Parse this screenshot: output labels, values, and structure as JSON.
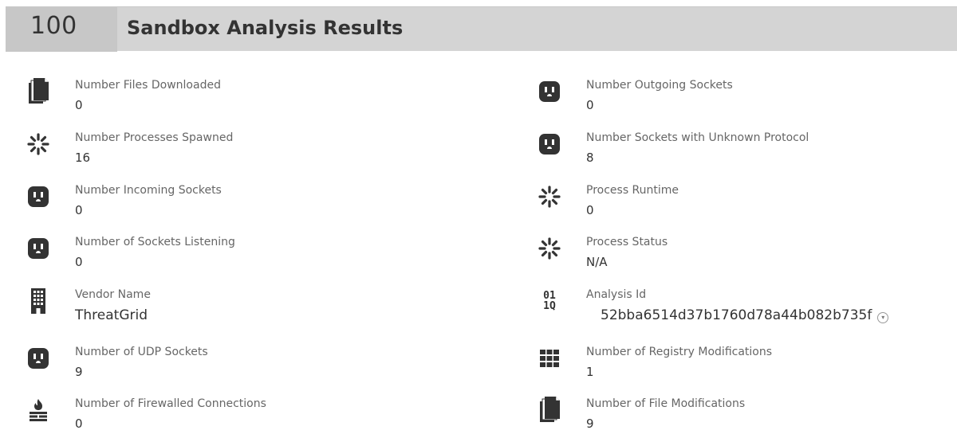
{
  "header": {
    "score": "100",
    "title": "Sandbox Analysis Results"
  },
  "left": [
    {
      "label": "Number Files Downloaded",
      "value": "0",
      "icon": "document-icon"
    },
    {
      "label": "Number Processes Spawned",
      "value": "16",
      "icon": "spinner-icon"
    },
    {
      "label": "Number Incoming Sockets",
      "value": "0",
      "icon": "socket-icon"
    },
    {
      "label": "Number of Sockets Listening",
      "value": "0",
      "icon": "socket-icon"
    },
    {
      "label": "Vendor Name",
      "value": "ThreatGrid",
      "icon": "building-icon"
    },
    {
      "label": "Number of UDP Sockets",
      "value": "9",
      "icon": "socket-icon"
    },
    {
      "label": "Number of Firewalled Connections",
      "value": "0",
      "icon": "firewall-icon"
    }
  ],
  "right": [
    {
      "label": "Number Outgoing Sockets",
      "value": "0",
      "icon": "socket-icon"
    },
    {
      "label": "Number Sockets with Unknown Protocol",
      "value": "8",
      "icon": "socket-icon"
    },
    {
      "label": "Process Runtime",
      "value": "0",
      "icon": "spinner-icon"
    },
    {
      "label": "Process Status",
      "value": "N/A",
      "icon": "spinner-icon"
    },
    {
      "label": "Analysis Id",
      "value": "52bba6514d37b1760d78a44b082b735f",
      "icon": "binary-search-icon",
      "icon_text_top": "01",
      "icon_text_bottom": "1Q"
    },
    {
      "label": "Number of Registry Modifications",
      "value": "1",
      "icon": "grid-icon"
    },
    {
      "label": "Number of File Modifications",
      "value": "9",
      "icon": "document-icon"
    }
  ],
  "colors": {
    "header_bg": "#d4d4d4",
    "score_bg": "#c7c7c7",
    "icon": "#333333",
    "label": "#666666"
  }
}
